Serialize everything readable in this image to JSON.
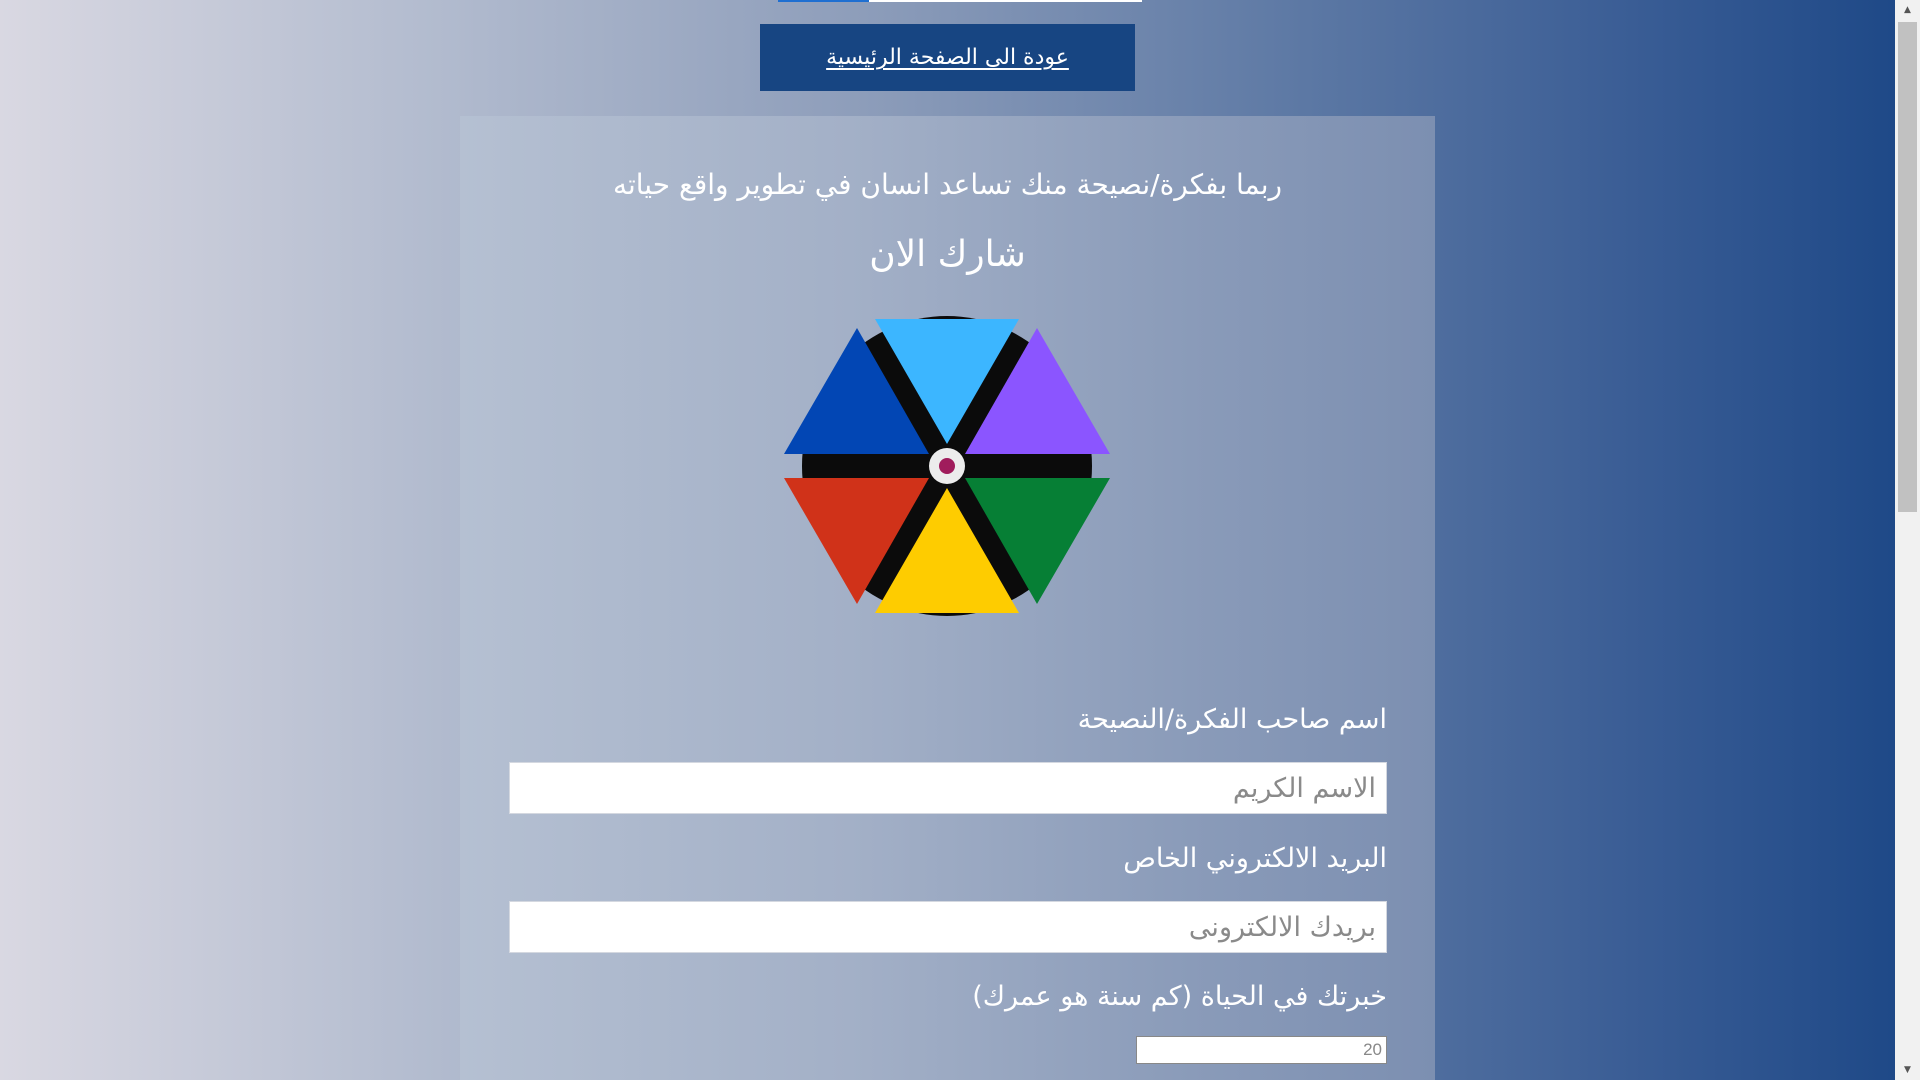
{
  "nav": {
    "home_button_label": "عودة الى الصفحة الرئيسية",
    "progress_fraction": 0.25
  },
  "intro": {
    "subtitle": "ربما بفكرة/نصيحة منك تساعد انسان في تطوير واقع حياته",
    "heading": "شارك الان"
  },
  "logo": {
    "segment_colors": [
      "#3cb6ff",
      "#8b55ff",
      "#067f35",
      "#fecc00",
      "#d03219",
      "#0246b4"
    ],
    "hub_color": "#a01c5c"
  },
  "form": {
    "name_label": "اسم صاحب الفكرة/النصيحة",
    "name_placeholder": "الاسم الكريم",
    "email_label": "البريد الالكتروني الخاص",
    "email_placeholder": "بريدك الالكترونى",
    "age_label": "خبرتك في الحياة (كم سنة هو عمرك)",
    "age_value": "20"
  },
  "scrollbar": {
    "up_arrow": "▲",
    "down_arrow": "▼"
  },
  "colors": {
    "button_bg": "#174582",
    "progress_fill": "#1f6fd1"
  }
}
